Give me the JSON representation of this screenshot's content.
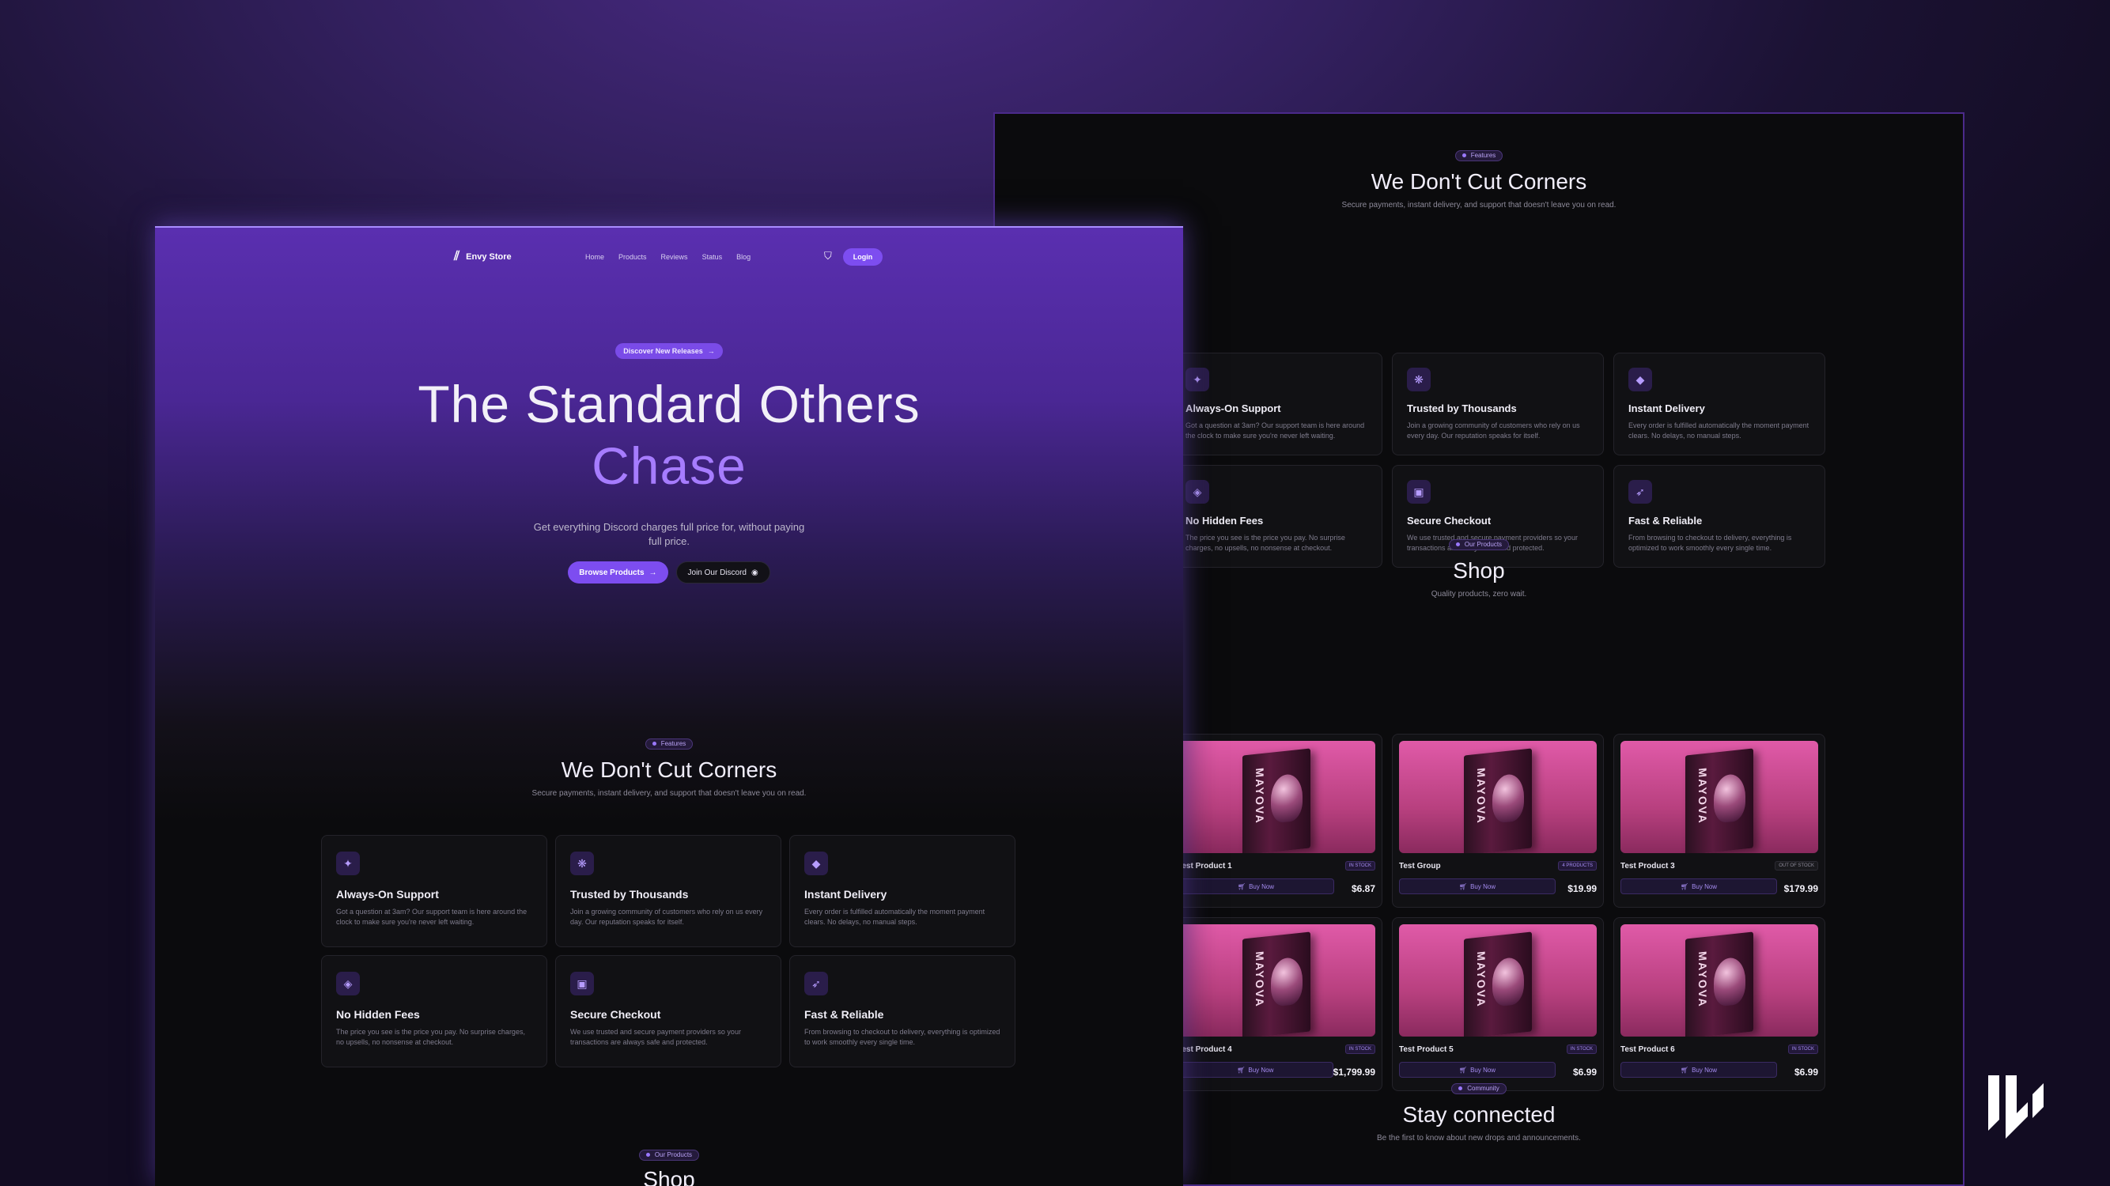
{
  "nav": {
    "brand": "Envy Store",
    "links": [
      "Home",
      "Products",
      "Reviews",
      "Status",
      "Blog"
    ],
    "login": "Login"
  },
  "hero": {
    "badge": "Discover New Releases",
    "title": "The Standard Others",
    "accent": "Chase",
    "description": "Get everything Discord charges full price for, without paying full price.",
    "primary_cta": "Browse Products",
    "secondary_cta": "Join Our Discord"
  },
  "features": {
    "pill": "Features",
    "title": "We Don't Cut Corners",
    "subtitle": "Secure payments, instant delivery, and support that doesn't leave you on read.",
    "items": [
      {
        "title": "Always-On Support",
        "desc": "Got a question at 3am? Our support team is here around the clock to make sure you're never left waiting.",
        "icon": "headset-icon"
      },
      {
        "title": "Trusted by Thousands",
        "desc": "Join a growing community of customers who rely on us every day. Our reputation speaks for itself.",
        "icon": "users-icon"
      },
      {
        "title": "Instant Delivery",
        "desc": "Every order is fulfilled automatically the moment payment clears. No delays, no manual steps.",
        "icon": "bolt-icon"
      },
      {
        "title": "No Hidden Fees",
        "desc": "The price you see is the price you pay. No surprise charges, no upsells, no nonsense at checkout.",
        "icon": "tag-icon"
      },
      {
        "title": "Secure Checkout",
        "desc": "We use trusted and secure payment providers so your transactions are always safe and protected.",
        "icon": "lock-icon"
      },
      {
        "title": "Fast & Reliable",
        "desc": "From browsing to checkout to delivery, everything is optimized to work smoothly every single time.",
        "icon": "rocket-icon"
      }
    ]
  },
  "shop": {
    "pill": "Our Products",
    "title": "Shop",
    "subtitle": "Quality products, zero wait.",
    "products": [
      {
        "name": "Test Product 1",
        "badge": "IN STOCK",
        "price": "$6.87",
        "buy": "Buy Now"
      },
      {
        "name": "Test Group",
        "badge": "4 PRODUCTS",
        "price": "$19.99",
        "buy": "Buy Now"
      },
      {
        "name": "Test Product 3",
        "badge": "OUT OF STOCK",
        "price": "$179.99",
        "buy": "Buy Now"
      },
      {
        "name": "Test Product 4",
        "badge": "IN STOCK",
        "price": "$1,799.99",
        "buy": "Buy Now"
      },
      {
        "name": "Test Product 5",
        "badge": "IN STOCK",
        "price": "$6.99",
        "buy": "Buy Now"
      },
      {
        "name": "Test Product 6",
        "badge": "IN STOCK",
        "price": "$6.99",
        "buy": "Buy Now"
      }
    ],
    "box_text": "MAYOVA"
  },
  "community": {
    "pill": "Community",
    "title": "Stay connected",
    "subtitle": "Be the first to know about new drops and announcements."
  },
  "colors": {
    "accent": "#7d4df0",
    "accent_light": "#a67cff",
    "product_bg": "#e05aa8",
    "background": "#0b0b0d"
  }
}
